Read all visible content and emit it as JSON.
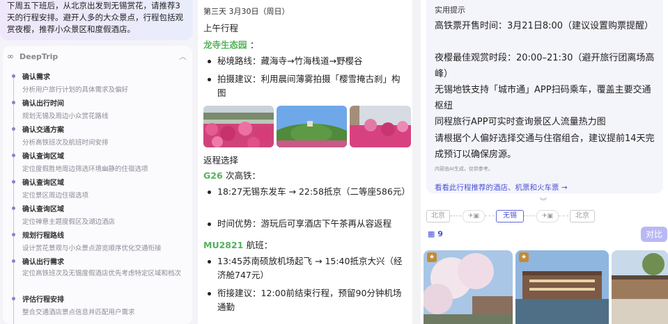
{
  "left": {
    "query": "下周五下班后，从北京出发到无锡赏花，请推荐3天的行程安排。避开人多的大众景点，行程包括观赏夜樱，推荐小众景区和度假酒店。",
    "brand": "DeepTrip",
    "logo_icon": "infinity-icon",
    "steps": [
      {
        "title": "确认需求",
        "desc": "分析用户旅行计划的具体需求及偏好"
      },
      {
        "title": "确认出行时间",
        "desc": "规划无锡及周边小众赏花路线"
      },
      {
        "title": "确认交通方案",
        "desc": "分析高铁班次及航班时间安排"
      },
      {
        "title": "确认查询区域",
        "desc": "定位度假胜地周边筛选环境幽静的住宿选项"
      },
      {
        "title": "确认查询区域",
        "desc": "定位景区周边住宿选项"
      },
      {
        "title": "确认查询区域",
        "desc": "定位禅意主题度假区及湖边酒店"
      },
      {
        "title": "规划行程路线",
        "desc": "设计赏花景观与小众景点游览顺序优化交通衔接"
      },
      {
        "title": "确认出行需求",
        "desc": "定位高铁班次及无锡度假酒店优先考虑特定区域和档次"
      },
      {
        "title": "评估行程安排",
        "desc": "整合交通酒店景点信息并匹配用户需求"
      }
    ]
  },
  "middle": {
    "date": "第三天 3月30日（周日）",
    "morning": "上午行程",
    "spot": "龙寺生态园",
    "spot_suffix": "：",
    "spot_bullets": [
      "秘境路线：藏海寺→竹海栈道→野樱谷",
      "拍摄建议：利用晨间薄雾拍摄「樱雪掩古刹」构图"
    ],
    "return": "返程选择",
    "train_code": "G26",
    "train_suffix": "次高铁：",
    "train_bullets": [
      "18:27无锡东发车 → 22:58抵京（二等座586元）",
      "时间优势：游玩后可享酒店下午茶再从容返程"
    ],
    "flight_code": "MU2821",
    "flight_suffix": "航班：",
    "flight_bullets": [
      "13:45苏南硕放机场起飞 → 15:40抵京大兴（经济舱747元）",
      "衔接建议：12:00前结束行程，预留90分钟机场通勤"
    ]
  },
  "right": {
    "tip_title": "实用提示",
    "tips": [
      "高铁票开售时间：3月21日8:00（建议设置购票提醒）",
      "夜樱最佳观赏时段：20:00–21:30（避开旅行团离场高峰）",
      "无锡地铁支持「城市通」APP扫码乘车，覆盖主要交通枢纽",
      "同程旅行APP可实时查询景区人流量热力图",
      "请根据个人偏好选择交通与住宿组合，建议提前14天完成预订以确保房源。"
    ],
    "ai_note": "内容由AI生成，仅供参考。",
    "link": "看看此行程推荐的酒店、机票和火车票 →",
    "route": [
      "北京",
      "无锡",
      "北京"
    ],
    "hotel_count": "9",
    "compare": "对比",
    "colors": {
      "accent": "#4a52d9",
      "green": "#52b35a"
    }
  }
}
